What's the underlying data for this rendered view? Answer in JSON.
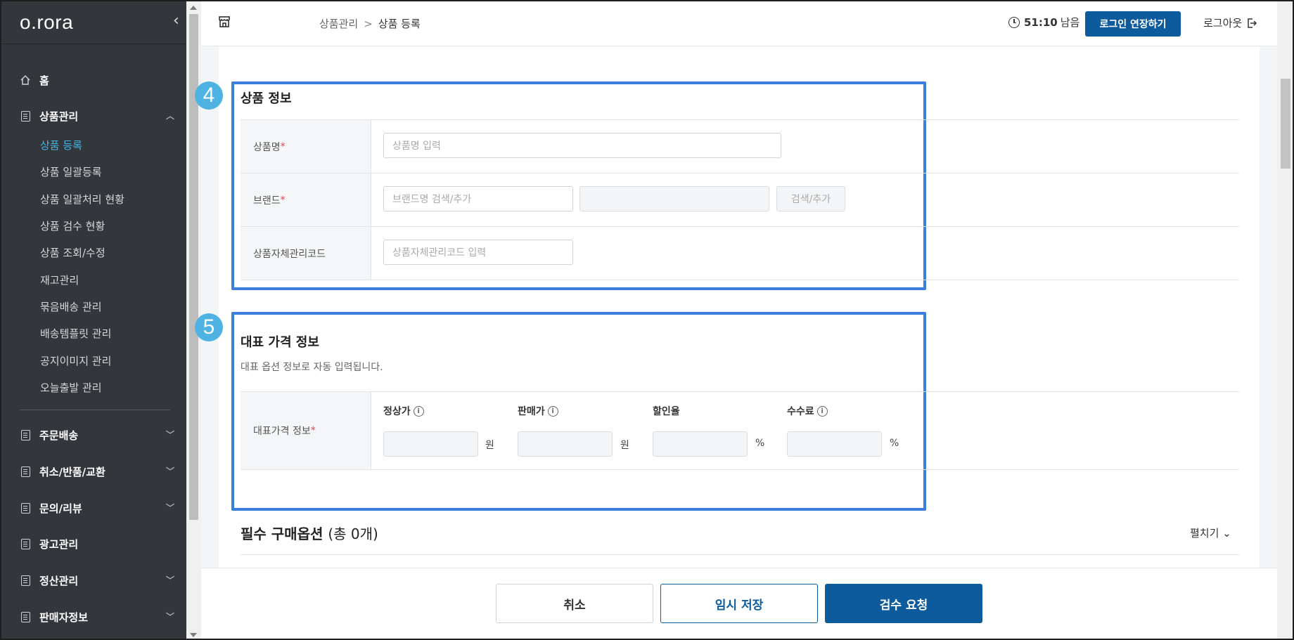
{
  "sidebar": {
    "logo": "o.rora",
    "items": [
      {
        "label": "홈"
      },
      {
        "label": "상품관리"
      },
      {
        "label": "주문배송"
      },
      {
        "label": "취소/반품/교환"
      },
      {
        "label": "문의/리뷰"
      },
      {
        "label": "광고관리"
      },
      {
        "label": "정산관리"
      },
      {
        "label": "판매자정보"
      }
    ],
    "sub_items": [
      {
        "label": "상품 등록",
        "active": true
      },
      {
        "label": "상품 일괄등록"
      },
      {
        "label": "상품 일괄처리 현황"
      },
      {
        "label": "상품 검수 현황"
      },
      {
        "label": "상품 조회/수정"
      },
      {
        "label": "재고관리"
      },
      {
        "label": "묶음배송 관리"
      },
      {
        "label": "배송템플릿 관리"
      },
      {
        "label": "공지이미지 관리"
      },
      {
        "label": "오늘출발 관리"
      }
    ]
  },
  "header": {
    "breadcrumb": {
      "parent": "상품관리",
      "separator": ">",
      "current": "상품 등록"
    },
    "timer": {
      "time": "51:10",
      "suffix": "남음"
    },
    "extend_label": "로그인 연장하기",
    "logout_label": "로그아웃"
  },
  "product_info": {
    "badge": "4",
    "title": "상품 정보",
    "name_label": "상품명",
    "name_placeholder": "상품명 입력",
    "brand_label": "브랜드",
    "brand_placeholder": "브랜드명 검색/추가",
    "brand_button": "검색/추가",
    "code_label": "상품자체관리코드",
    "code_placeholder": "상품자체관리코드 입력",
    "required_mark": "*"
  },
  "price_info": {
    "badge": "5",
    "title": "대표 가격 정보",
    "desc": "대표 옵션 정보로 자동 입력됩니다.",
    "row_label": "대표가격 정보",
    "fields": [
      {
        "label": "정상가",
        "unit": "원",
        "info": true
      },
      {
        "label": "판매가",
        "unit": "원",
        "info": true
      },
      {
        "label": "할인율",
        "unit": "%",
        "info": false
      },
      {
        "label": "수수료",
        "unit": "%",
        "info": true
      }
    ]
  },
  "options": {
    "title": "필수 구매옵션",
    "count": "(총 0개)",
    "expand_label": "펼치기"
  },
  "footer": {
    "cancel": "취소",
    "temp_save": "임시 저장",
    "submit": "검수 요청"
  },
  "colors": {
    "sidebar_bg": "#33363a",
    "active": "#41b6e6",
    "primary": "#0d5a9c",
    "highlight": "#3d7fdc",
    "badge": "#4eb3e3",
    "required": "#e0435a"
  }
}
